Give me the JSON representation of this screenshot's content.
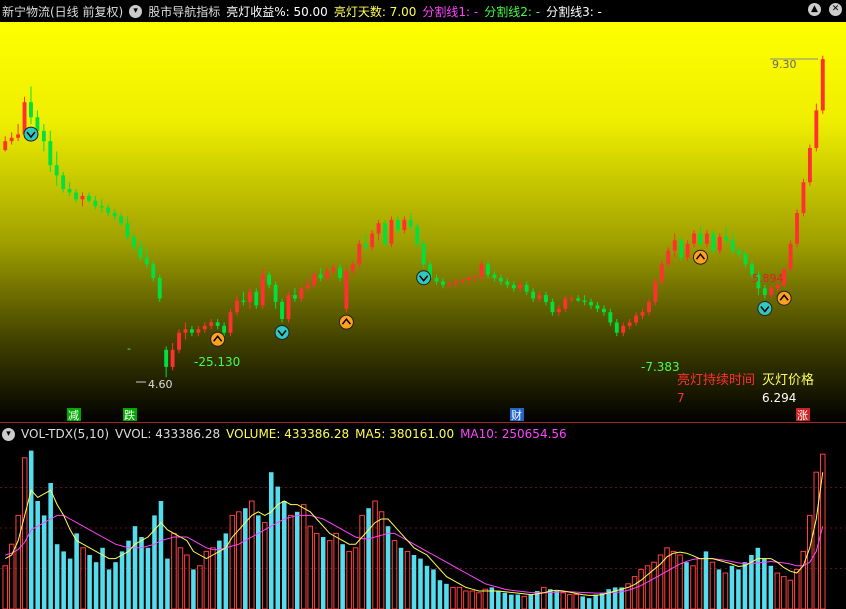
{
  "header": {
    "stock_title": "新宁物流(日线 前复权)",
    "indicator_name": "股市导航指标",
    "profit_label": "亮灯收益%: 50.00",
    "days_label": "亮灯天数: 7.00",
    "split1_label": "分割线1: -",
    "split2_label": "分割线2: -",
    "split3_label": "分割线3: -",
    "colors": {
      "profit": "#ffffff",
      "days": "#ffff55",
      "split1": "#ff44ff",
      "split2": "#44ff44",
      "split3": "#ffffff"
    }
  },
  "volume_header": {
    "name": "VOL-TDX(5,10)",
    "vvol": "VVOL: 433386.28",
    "volume": "VOLUME: 433386.28",
    "ma5": "MA5: 380161.00",
    "ma10": "MA10: 250654.56",
    "colors": {
      "volume": "#ffff55",
      "ma5": "#ffff55",
      "ma10": "#ff44ff"
    }
  },
  "annotations": {
    "low_label": "4.60",
    "pct1": "-25.130",
    "pct2": "-7.383",
    "high_label": "9.30",
    "sell_price": "5.894",
    "duration_title": "亮灯持续时间",
    "duration_value": "7",
    "off_price_title": "灭灯价格",
    "off_price_value": "6.294",
    "dash": "-"
  },
  "markers": {
    "jian": "减",
    "die": "跌",
    "cai": "财",
    "zhang": "涨"
  },
  "chart_data": [
    {
      "type": "candlestick",
      "ylim": [
        4.5,
        9.5
      ],
      "colors": {
        "up": "#ff3030",
        "down": "#00e040"
      },
      "candles": [
        [
          7.92,
          8.12,
          7.9,
          8.05
        ],
        [
          8.05,
          8.18,
          8.0,
          8.1
        ],
        [
          8.1,
          8.3,
          8.05,
          8.15
        ],
        [
          8.15,
          8.7,
          8.1,
          8.62
        ],
        [
          8.62,
          8.85,
          8.3,
          8.4
        ],
        [
          8.4,
          8.5,
          8.1,
          8.2
        ],
        [
          8.2,
          8.3,
          7.9,
          8.05
        ],
        [
          8.05,
          8.2,
          7.6,
          7.7
        ],
        [
          7.7,
          7.9,
          7.4,
          7.55
        ],
        [
          7.55,
          7.6,
          7.3,
          7.35
        ],
        [
          7.35,
          7.45,
          7.25,
          7.3
        ],
        [
          7.3,
          7.35,
          7.15,
          7.2
        ],
        [
          7.2,
          7.3,
          7.1,
          7.25
        ],
        [
          7.25,
          7.3,
          7.15,
          7.18
        ],
        [
          7.18,
          7.25,
          7.05,
          7.1
        ],
        [
          7.1,
          7.2,
          7.0,
          7.08
        ],
        [
          7.08,
          7.12,
          6.95,
          7.0
        ],
        [
          7.0,
          7.05,
          6.9,
          6.95
        ],
        [
          6.95,
          7.0,
          6.8,
          6.85
        ],
        [
          6.85,
          6.95,
          6.6,
          6.65
        ],
        [
          6.65,
          6.7,
          6.45,
          6.5
        ],
        [
          6.5,
          6.6,
          6.3,
          6.35
        ],
        [
          6.35,
          6.5,
          6.2,
          6.25
        ],
        [
          6.25,
          6.3,
          6.0,
          6.05
        ],
        [
          6.05,
          6.1,
          5.7,
          5.75
        ],
        [
          5.0,
          5.05,
          4.6,
          4.75
        ],
        [
          4.75,
          5.1,
          4.7,
          5.0
        ],
        [
          5.0,
          5.3,
          4.95,
          5.25
        ],
        [
          5.25,
          5.4,
          5.15,
          5.3
        ],
        [
          5.3,
          5.35,
          5.2,
          5.25
        ],
        [
          5.25,
          5.35,
          5.2,
          5.3
        ],
        [
          5.3,
          5.4,
          5.25,
          5.35
        ],
        [
          5.35,
          5.45,
          5.3,
          5.4
        ],
        [
          5.4,
          5.45,
          5.3,
          5.35
        ],
        [
          5.35,
          5.4,
          5.2,
          5.25
        ],
        [
          5.25,
          5.6,
          5.2,
          5.55
        ],
        [
          5.55,
          5.8,
          5.5,
          5.72
        ],
        [
          5.72,
          5.85,
          5.65,
          5.7
        ],
        [
          5.7,
          5.9,
          5.6,
          5.85
        ],
        [
          5.85,
          5.9,
          5.6,
          5.65
        ],
        [
          5.65,
          6.2,
          5.6,
          6.1
        ],
        [
          6.1,
          6.15,
          5.9,
          5.95
        ],
        [
          5.95,
          6.0,
          5.6,
          5.7
        ],
        [
          5.7,
          5.75,
          5.4,
          5.45
        ],
        [
          5.45,
          5.85,
          5.4,
          5.8
        ],
        [
          5.8,
          5.9,
          5.7,
          5.75
        ],
        [
          5.75,
          5.95,
          5.7,
          5.9
        ],
        [
          5.9,
          6.05,
          5.85,
          5.95
        ],
        [
          5.95,
          6.15,
          5.9,
          6.1
        ],
        [
          6.1,
          6.2,
          6.0,
          6.05
        ],
        [
          6.05,
          6.2,
          6.0,
          6.15
        ],
        [
          6.15,
          6.25,
          6.1,
          6.2
        ],
        [
          6.2,
          6.25,
          6.0,
          6.05
        ],
        [
          5.6,
          6.2,
          5.55,
          6.15
        ],
        [
          6.15,
          6.3,
          6.1,
          6.25
        ],
        [
          6.25,
          6.6,
          6.2,
          6.55
        ],
        [
          6.55,
          6.7,
          6.45,
          6.5
        ],
        [
          6.5,
          6.75,
          6.45,
          6.7
        ],
        [
          6.7,
          6.9,
          6.6,
          6.85
        ],
        [
          6.85,
          6.9,
          6.5,
          6.55
        ],
        [
          6.55,
          6.95,
          6.5,
          6.9
        ],
        [
          6.9,
          6.95,
          6.7,
          6.75
        ],
        [
          6.75,
          6.95,
          6.7,
          6.9
        ],
        [
          6.9,
          7.0,
          6.75,
          6.8
        ],
        [
          6.8,
          6.85,
          6.5,
          6.55
        ],
        [
          6.55,
          6.6,
          6.2,
          6.25
        ],
        [
          6.25,
          6.3,
          6.0,
          6.05
        ],
        [
          6.05,
          6.1,
          5.95,
          6.0
        ],
        [
          6.0,
          6.05,
          5.9,
          5.95
        ],
        [
          5.95,
          6.0,
          5.9,
          5.97
        ],
        [
          5.97,
          6.05,
          5.9,
          6.0
        ],
        [
          6.0,
          6.05,
          5.95,
          6.02
        ],
        [
          6.02,
          6.1,
          5.95,
          6.05
        ],
        [
          6.05,
          6.1,
          6.0,
          6.07
        ],
        [
          6.07,
          6.3,
          6.0,
          6.25
        ],
        [
          6.25,
          6.3,
          6.05,
          6.1
        ],
        [
          6.1,
          6.15,
          6.0,
          6.05
        ],
        [
          6.05,
          6.1,
          5.95,
          6.0
        ],
        [
          6.0,
          6.05,
          5.9,
          5.95
        ],
        [
          5.95,
          6.0,
          5.85,
          5.9
        ],
        [
          5.9,
          6.0,
          5.85,
          5.95
        ],
        [
          5.95,
          6.0,
          5.8,
          5.85
        ],
        [
          5.85,
          5.9,
          5.7,
          5.75
        ],
        [
          5.75,
          5.85,
          5.7,
          5.8
        ],
        [
          5.8,
          5.85,
          5.65,
          5.7
        ],
        [
          5.7,
          5.75,
          5.5,
          5.55
        ],
        [
          5.55,
          5.65,
          5.5,
          5.6
        ],
        [
          5.6,
          5.8,
          5.55,
          5.75
        ],
        [
          5.75,
          5.8,
          5.7,
          5.75
        ],
        [
          5.75,
          5.8,
          5.7,
          5.72
        ],
        [
          5.72,
          5.8,
          5.65,
          5.7
        ],
        [
          5.7,
          5.75,
          5.6,
          5.65
        ],
        [
          5.65,
          5.7,
          5.55,
          5.6
        ],
        [
          5.6,
          5.65,
          5.5,
          5.55
        ],
        [
          5.55,
          5.6,
          5.35,
          5.4
        ],
        [
          5.4,
          5.45,
          5.2,
          5.25
        ],
        [
          5.25,
          5.4,
          5.2,
          5.35
        ],
        [
          5.35,
          5.45,
          5.3,
          5.4
        ],
        [
          5.4,
          5.55,
          5.35,
          5.5
        ],
        [
          5.5,
          5.6,
          5.45,
          5.55
        ],
        [
          5.55,
          5.75,
          5.5,
          5.7
        ],
        [
          5.7,
          6.05,
          5.65,
          6.0
        ],
        [
          6.0,
          6.3,
          5.95,
          6.25
        ],
        [
          6.25,
          6.5,
          6.2,
          6.45
        ],
        [
          6.45,
          6.7,
          6.35,
          6.6
        ],
        [
          6.6,
          6.65,
          6.3,
          6.35
        ],
        [
          6.35,
          6.6,
          6.3,
          6.55
        ],
        [
          6.55,
          6.75,
          6.5,
          6.7
        ],
        [
          6.7,
          6.8,
          6.5,
          6.55
        ],
        [
          6.55,
          6.75,
          6.5,
          6.7
        ],
        [
          6.7,
          6.75,
          6.4,
          6.45
        ],
        [
          6.45,
          6.7,
          6.4,
          6.65
        ],
        [
          6.65,
          6.8,
          6.55,
          6.6
        ],
        [
          6.6,
          6.7,
          6.4,
          6.45
        ],
        [
          6.45,
          6.5,
          6.35,
          6.4
        ],
        [
          6.4,
          6.45,
          6.2,
          6.25
        ],
        [
          6.25,
          6.3,
          6.05,
          6.1
        ],
        [
          6.1,
          6.15,
          5.8,
          5.9
        ],
        [
          5.9,
          5.95,
          5.75,
          5.8
        ],
        [
          5.8,
          5.95,
          5.75,
          5.9
        ],
        [
          5.9,
          6.0,
          5.85,
          5.95
        ],
        [
          5.95,
          6.2,
          5.9,
          6.18
        ],
        [
          6.18,
          6.6,
          6.15,
          6.55
        ],
        [
          6.55,
          7.05,
          6.5,
          7.0
        ],
        [
          7.0,
          7.5,
          6.95,
          7.45
        ],
        [
          7.45,
          8.0,
          7.4,
          7.95
        ],
        [
          7.95,
          8.6,
          7.9,
          8.5
        ],
        [
          8.5,
          9.3,
          8.45,
          9.25
        ]
      ]
    },
    {
      "type": "bar",
      "ylim": [
        0,
        450000
      ],
      "volumes": [
        120,
        180,
        260,
        420,
        440,
        300,
        260,
        350,
        180,
        160,
        140,
        210,
        170,
        150,
        130,
        170,
        110,
        130,
        160,
        190,
        230,
        200,
        170,
        260,
        300,
        140,
        210,
        170,
        150,
        110,
        120,
        160,
        170,
        190,
        210,
        260,
        270,
        280,
        300,
        260,
        240,
        380,
        340,
        300,
        260,
        270,
        290,
        230,
        210,
        200,
        190,
        210,
        180,
        160,
        170,
        260,
        280,
        300,
        270,
        230,
        190,
        170,
        160,
        150,
        140,
        120,
        110,
        80,
        70,
        60,
        60,
        50,
        50,
        45,
        55,
        60,
        50,
        45,
        40,
        40,
        35,
        40,
        50,
        60,
        55,
        50,
        45,
        40,
        40,
        35,
        30,
        40,
        45,
        55,
        60,
        60,
        70,
        90,
        110,
        120,
        130,
        150,
        170,
        160,
        150,
        130,
        120,
        140,
        160,
        130,
        110,
        100,
        120,
        110,
        130,
        150,
        170,
        140,
        120,
        100,
        90,
        80,
        110,
        160,
        260,
        380,
        430
      ],
      "ma5": [
        140,
        150,
        190,
        260,
        330,
        310,
        320,
        330,
        290,
        260,
        220,
        190,
        180,
        170,
        160,
        150,
        140,
        140,
        150,
        160,
        180,
        190,
        200,
        220,
        240,
        220,
        210,
        200,
        190,
        160,
        150,
        140,
        150,
        160,
        170,
        200,
        220,
        240,
        260,
        270,
        260,
        270,
        290,
        300,
        290,
        290,
        280,
        270,
        250,
        230,
        210,
        200,
        190,
        180,
        180,
        200,
        220,
        240,
        250,
        250,
        230,
        210,
        190,
        170,
        160,
        150,
        130,
        110,
        90,
        80,
        70,
        60,
        55,
        50,
        50,
        50,
        50,
        48,
        46,
        44,
        42,
        40,
        42,
        45,
        50,
        52,
        50,
        47,
        43,
        40,
        38,
        38,
        40,
        45,
        50,
        55,
        60,
        68,
        80,
        95,
        110,
        125,
        145,
        155,
        158,
        155,
        148,
        140,
        140,
        140,
        135,
        130,
        125,
        118,
        120,
        130,
        140,
        140,
        140,
        130,
        115,
        105,
        100,
        120,
        170,
        250,
        380
      ],
      "ma10": [
        150,
        155,
        165,
        185,
        220,
        230,
        240,
        250,
        260,
        260,
        250,
        240,
        230,
        220,
        210,
        200,
        190,
        180,
        175,
        170,
        170,
        170,
        175,
        180,
        190,
        195,
        200,
        200,
        200,
        190,
        180,
        170,
        165,
        165,
        170,
        175,
        180,
        190,
        200,
        210,
        220,
        230,
        240,
        250,
        255,
        260,
        260,
        260,
        255,
        250,
        240,
        230,
        220,
        210,
        200,
        195,
        195,
        200,
        205,
        210,
        210,
        200,
        190,
        180,
        170,
        160,
        150,
        140,
        130,
        120,
        110,
        100,
        90,
        80,
        70,
        65,
        60,
        55,
        52,
        50,
        48,
        46,
        45,
        45,
        46,
        47,
        48,
        48,
        47,
        46,
        45,
        44,
        44,
        45,
        46,
        48,
        52,
        58,
        65,
        75,
        85,
        95,
        105,
        115,
        125,
        132,
        138,
        140,
        140,
        140,
        138,
        135,
        132,
        128,
        126,
        126,
        128,
        130,
        132,
        130,
        128,
        125,
        120,
        120,
        130,
        160,
        230
      ]
    }
  ]
}
